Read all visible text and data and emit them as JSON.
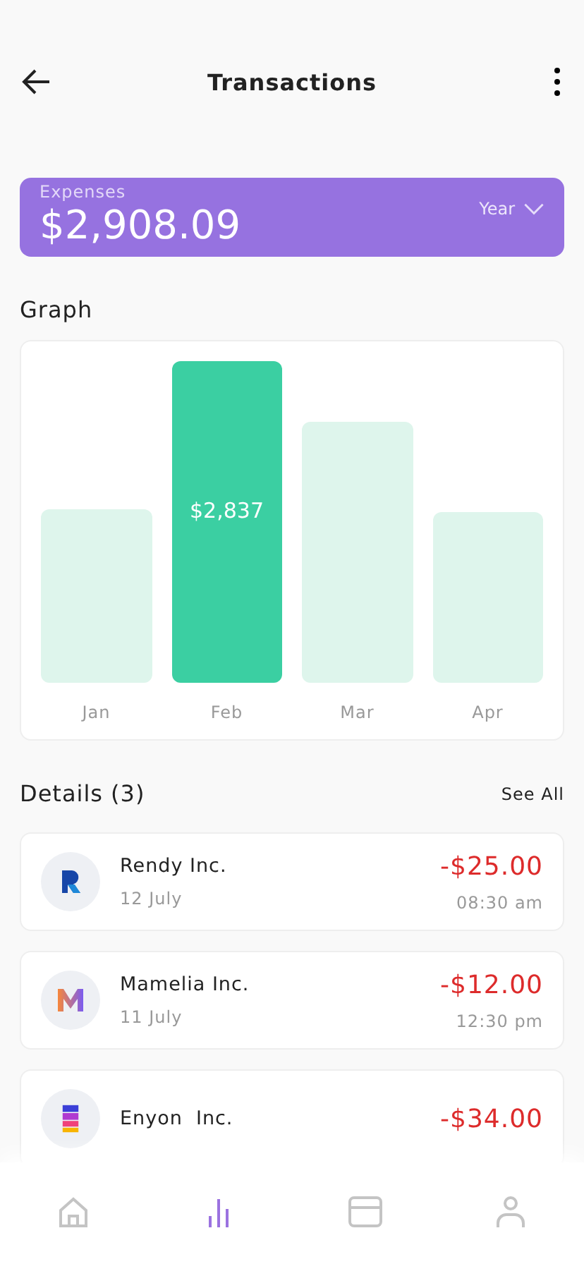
{
  "header": {
    "title": "Transactions"
  },
  "summary": {
    "label": "Expenses",
    "amount": "$2,908.09",
    "period": "Year"
  },
  "graph": {
    "title": "Graph",
    "bars": [
      {
        "label": "Jan",
        "selected": false
      },
      {
        "label": "Feb",
        "selected": true,
        "value": "$2,837"
      },
      {
        "label": "Mar",
        "selected": false
      },
      {
        "label": "Apr",
        "selected": false
      }
    ]
  },
  "details": {
    "title": "Details (3)",
    "link": "See All",
    "items": [
      {
        "kind": "blue",
        "name": "Rendy Inc.",
        "date": "12 July",
        "amount": "-$25.00",
        "time": "08:30 am"
      },
      {
        "kind": "gradient",
        "name": "Mamelia Inc.",
        "date": "11 July",
        "amount": "-$12.00",
        "time": "12:30 pm"
      },
      {
        "kind": "stripes",
        "name": "Enyon  Inc.",
        "amount": "-$34.00"
      }
    ]
  },
  "nav": [
    {
      "kind": "home",
      "selected": false
    },
    {
      "kind": "chart",
      "selected": true
    },
    {
      "kind": "card",
      "selected": false
    },
    {
      "kind": "profile",
      "selected": false
    }
  ]
}
